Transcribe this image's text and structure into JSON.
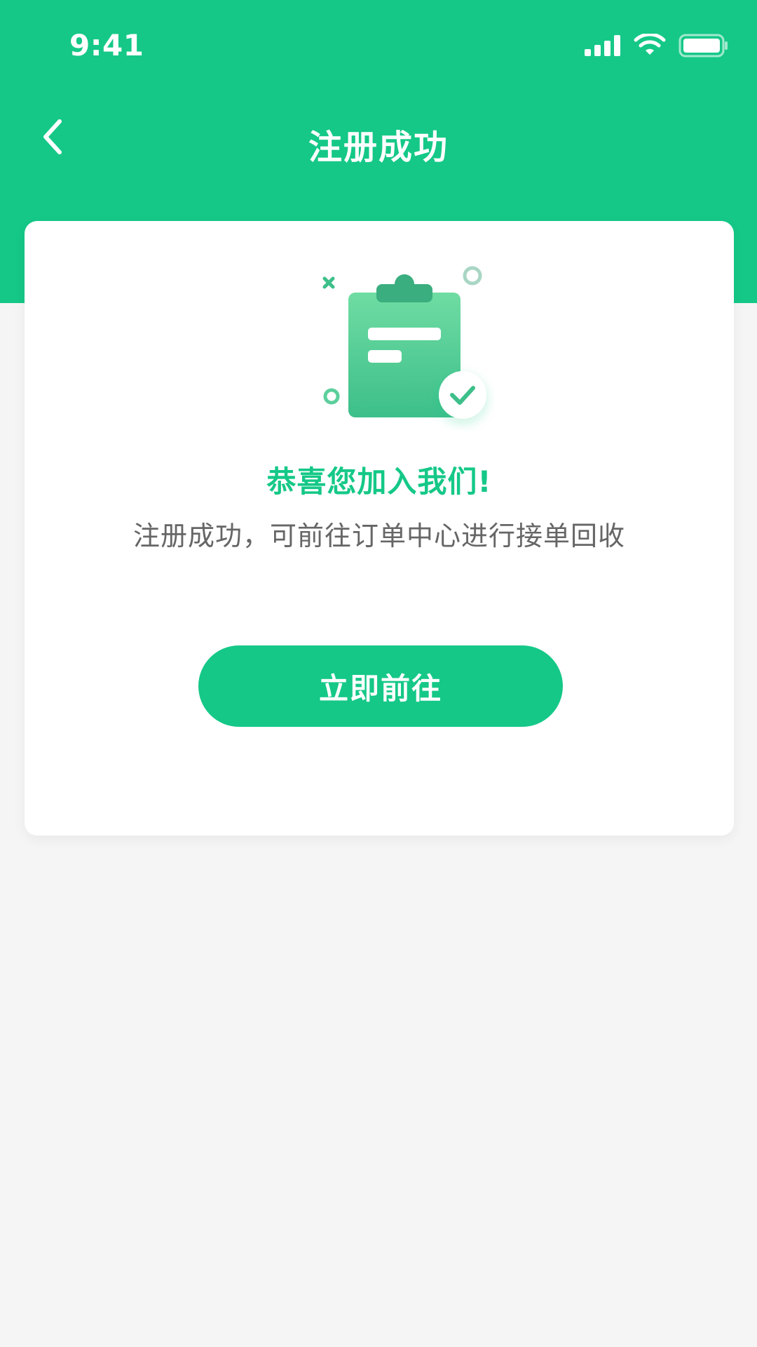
{
  "status_bar": {
    "time": "9:41",
    "icons": [
      "signal-icon",
      "wifi-icon",
      "battery-icon"
    ]
  },
  "header": {
    "title": "注册成功",
    "back_icon": "chevron-left-icon"
  },
  "card": {
    "illustration": "clipboard-check-icon",
    "headline": "恭喜您加入我们!",
    "message": "注册成功，可前往订单中心进行接单回收",
    "button_label": "立即前往"
  },
  "colors": {
    "brand_green": "#15c887",
    "background": "#f5f5f5",
    "card": "#ffffff",
    "text_secondary": "#666666"
  }
}
